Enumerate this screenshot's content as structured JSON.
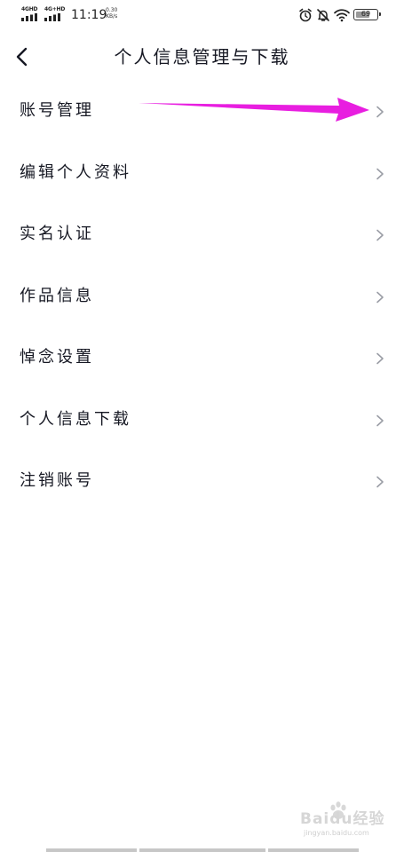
{
  "status_bar": {
    "network_1": "4GHD",
    "network_2": "4G+HD",
    "time": "11:19",
    "speed_value": "0.30",
    "speed_unit": "KB/s",
    "battery_level": "69",
    "battery_fraction": 0.69,
    "icons": [
      "alarm-icon",
      "mute-bell-icon",
      "wifi-icon",
      "battery-icon"
    ]
  },
  "header": {
    "back_icon": "chevron-left-icon",
    "title": "个人信息管理与下载"
  },
  "menu": {
    "items": [
      {
        "label": "账号管理",
        "icon": "chevron-right-icon"
      },
      {
        "label": "编辑个人资料",
        "icon": "chevron-right-icon"
      },
      {
        "label": "实名认证",
        "icon": "chevron-right-icon"
      },
      {
        "label": "作品信息",
        "icon": "chevron-right-icon"
      },
      {
        "label": "悼念设置",
        "icon": "chevron-right-icon"
      },
      {
        "label": "个人信息下载",
        "icon": "chevron-right-icon"
      },
      {
        "label": "注销账号",
        "icon": "chevron-right-icon"
      }
    ]
  },
  "annotation": {
    "arrow_color": "#e81ee0",
    "target": "账号管理"
  },
  "watermark": {
    "brand": "Baidu经验",
    "sub": "jingyan.baidu.com"
  },
  "colors": {
    "text": "#161823",
    "chevron": "#9a9da5",
    "background": "#ffffff"
  }
}
